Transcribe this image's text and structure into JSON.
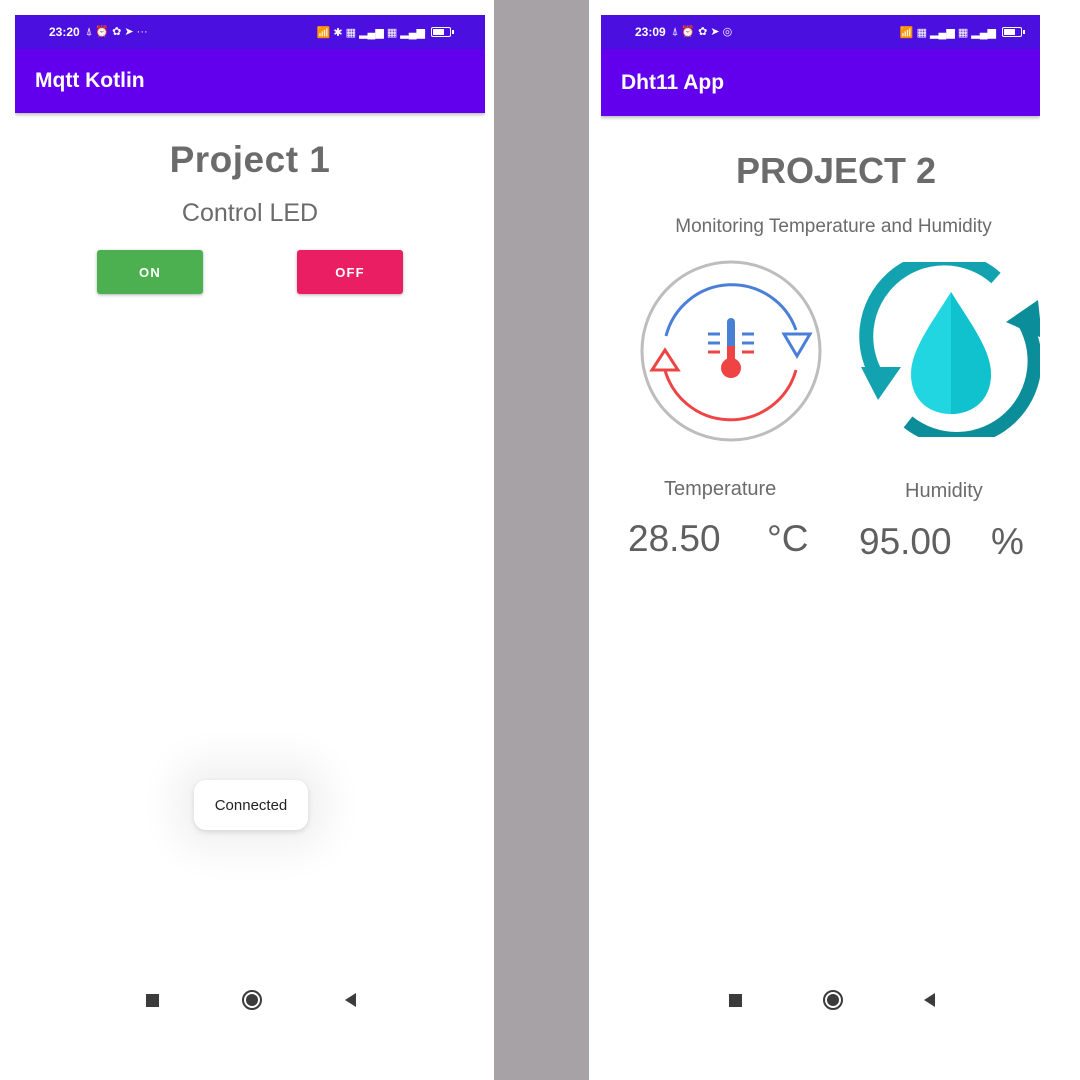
{
  "left_phone": {
    "status_bar": {
      "time": "23:20",
      "icons_left": "⍋ ⏰ ✿ ➤ ···",
      "icons_right": "📶 ✱ ▦ ▂▄▆ ▦ ▂▄▆"
    },
    "app_title": "Mqtt Kotlin",
    "title": "Project  1",
    "subtitle": "Control LED",
    "buttons": {
      "on_label": "ON",
      "off_label": "OFF"
    },
    "toast": "Connected",
    "colors": {
      "on": "#4caf50",
      "off": "#e91e63",
      "appbar": "#6200ee",
      "statusbar": "#4b0fe0"
    }
  },
  "right_phone": {
    "status_bar": {
      "time": "23:09",
      "icons_left": "⍋ ⏰ ✿ ➤ ◎",
      "icons_right": "📶 ▦ ▂▄▆ ▦ ▂▄▆"
    },
    "app_title": "Dht11 App",
    "title": "PROJECT 2",
    "subtitle": "Monitoring Temperature and Humidity",
    "temperature": {
      "label": "Temperature",
      "value": "28.50",
      "unit": "°C"
    },
    "humidity": {
      "label": "Humidity",
      "value": "95.00",
      "unit": "%"
    },
    "icons": {
      "temperature": "thermometer-cycle-icon",
      "humidity": "water-drop-cycle-icon"
    }
  },
  "nav_icons": [
    "recent-apps-icon",
    "home-icon",
    "back-icon"
  ]
}
